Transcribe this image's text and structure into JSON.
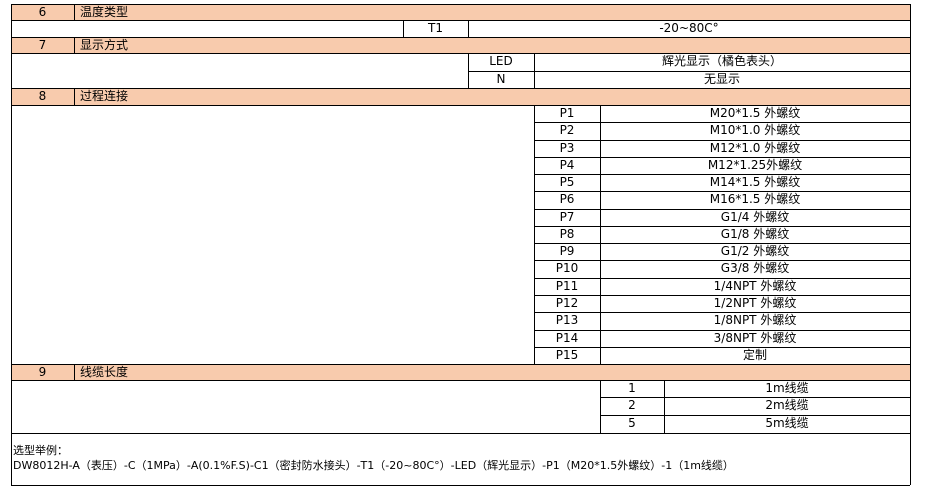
{
  "sections": [
    {
      "no": "6",
      "title": "温度类型"
    },
    {
      "no": "7",
      "title": "显示方式"
    },
    {
      "no": "8",
      "title": "过程连接"
    },
    {
      "no": "9",
      "title": "线缆长度"
    }
  ],
  "temperature": {
    "code": "T1",
    "desc": "-20~80C°"
  },
  "display": [
    {
      "code": "LED",
      "desc": "辉光显示（橘色表头）"
    },
    {
      "code": "N",
      "desc": "无显示"
    }
  ],
  "connection": [
    {
      "code": "P1",
      "desc": "M20*1.5 外螺纹"
    },
    {
      "code": "P2",
      "desc": "M10*1.0 外螺纹"
    },
    {
      "code": "P3",
      "desc": "M12*1.0 外螺纹"
    },
    {
      "code": "P4",
      "desc": "M12*1.25外螺纹"
    },
    {
      "code": "P5",
      "desc": "M14*1.5 外螺纹"
    },
    {
      "code": "P6",
      "desc": "M16*1.5 外螺纹"
    },
    {
      "code": "P7",
      "desc": "G1/4 外螺纹"
    },
    {
      "code": "P8",
      "desc": "G1/8 外螺纹"
    },
    {
      "code": "P9",
      "desc": "G1/2 外螺纹"
    },
    {
      "code": "P10",
      "desc": "G3/8 外螺纹"
    },
    {
      "code": "P11",
      "desc": "1/4NPT 外螺纹"
    },
    {
      "code": "P12",
      "desc": "1/2NPT 外螺纹"
    },
    {
      "code": "P13",
      "desc": "1/8NPT 外螺纹"
    },
    {
      "code": "P14",
      "desc": "3/8NPT 外螺纹"
    },
    {
      "code": "P15",
      "desc": "定制"
    }
  ],
  "cable": [
    {
      "code": "1",
      "desc": "1m线缆"
    },
    {
      "code": "2",
      "desc": "2m线缆"
    },
    {
      "code": "5",
      "desc": "5m线缆"
    }
  ],
  "example": {
    "label": "选型举例：",
    "text": "DW8012H-A（表压）-C（1MPa）-A(0.1%F.S)-C1（密封防水接头）-T1（-20~80C°）-LED（辉光显示）-P1（M20*1.5外螺纹）-1（1m线缆）"
  }
}
